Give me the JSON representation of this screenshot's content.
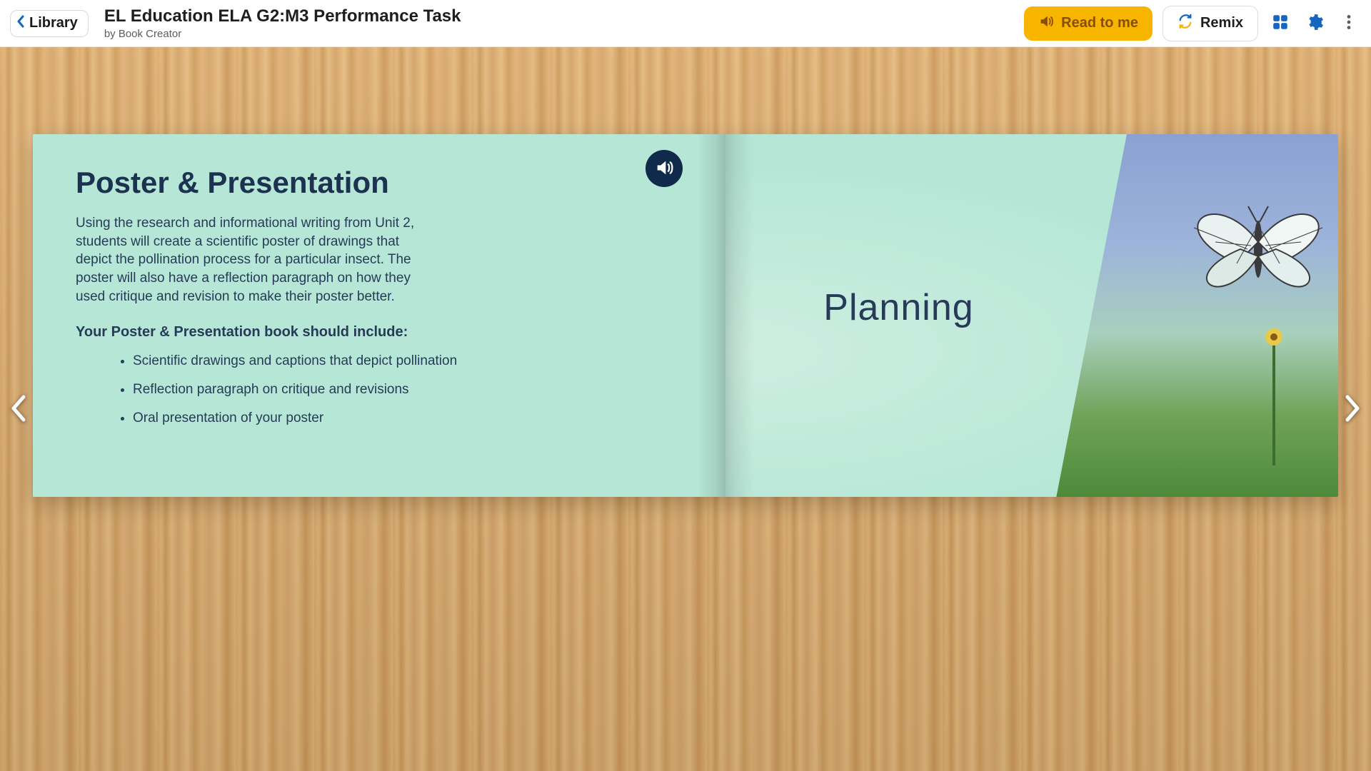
{
  "header": {
    "library_label": "Library",
    "title": "EL Education ELA G2:M3 Performance Task",
    "author_prefix": "by ",
    "author_name": "Book Creator",
    "read_to_me_label": "Read to me",
    "remix_label": "Remix"
  },
  "left_page": {
    "heading": "Poster & Presentation",
    "body": "Using the research and informational writing from Unit 2, students will create a scientific poster of drawings that depict the pollination process for a particular insect. The poster will also have a reflection paragraph on how they used critique and revision to make their poster better.",
    "subhead": "Your Poster & Presentation book should include:",
    "bullets": [
      "Scientific drawings and captions that depict pollination",
      "Reflection paragraph on critique and revisions",
      "Oral presentation of your poster"
    ]
  },
  "right_page": {
    "title": "Planning"
  },
  "icons": {
    "chevron_left": "chevron-left-icon",
    "speaker": "speaker-icon",
    "refresh": "refresh-icon",
    "grid": "grid-icon",
    "gear": "gear-icon",
    "more": "more-vertical-icon",
    "arrow_left": "arrow-left-icon",
    "arrow_right": "arrow-right-icon"
  },
  "colors": {
    "accent_blue": "#1466bf",
    "read_btn_bg": "#f7b500",
    "page_bg": "#B6E7D6",
    "text_dark": "#273a58"
  }
}
